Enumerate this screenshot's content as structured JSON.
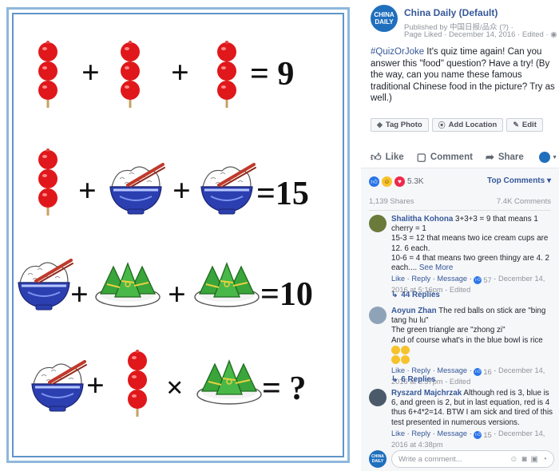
{
  "post": {
    "page_name": "China Daily (Default)",
    "published_by": "Published by 中国日报/品众 (?) · ",
    "page_liked": "Page Liked · December 14, 2016 · Edited · ",
    "avatar_text_1": "CHINA",
    "avatar_text_2": "DAILY",
    "hashtag": "#QuizOrJoke",
    "text": " It's quiz time again! Can you answer this \"food\" question? Have a try! (By the way, can you name these famous traditional Chinese food in the picture? Try as well.)"
  },
  "buttons": {
    "tag_photo": "Tag Photo",
    "add_location": "Add Location",
    "edit": "Edit",
    "like": "Like",
    "comment": "Comment",
    "share": "Share"
  },
  "stats": {
    "reactions": "5.3K",
    "top_comments": "Top Comments ▾",
    "shares": "1,139 Shares",
    "comments": "7.4K Comments"
  },
  "comments": [
    {
      "name": "Shalitha Kohona",
      "text": "3+3+3 = 9 that means 1 cherry = 1",
      "line2": "15-3 = 12 that means two ice cream cups are 12. 6 each.",
      "line3": "10-6 = 4 that means two green thingy are 4. 2 each....",
      "see_more": "See More",
      "like": "Like",
      "reply": "Reply",
      "message": "Message",
      "likes": "57",
      "date": "December 14, 2016 at 5:16pm",
      "edited": "Edited",
      "replies": "44 Replies"
    },
    {
      "name": "Aoyun Zhan",
      "text": "The red balls on stick are \"bing tang hu lu\"",
      "line2": "The green triangle are \"zhong zi\"",
      "line3": "And of course what's in the blue bowl is rice",
      "like": "Like",
      "reply": "Reply",
      "message": "Message",
      "likes": "16",
      "date": "December 14, 2016 at 5:37pm",
      "edited": "Edited",
      "replies": "6 Replies"
    },
    {
      "name": "Ryszard Majchrzak",
      "text": "Although red is 3, blue is 6, and green is 2, but in last equation, red is 4 thus 6+4*2=14. BTW I am sick and tired of this test presented in numerous versions.",
      "like": "Like",
      "reply": "Reply",
      "message": "Message",
      "likes": "15",
      "date": "December 14, 2016 at 4:38pm"
    }
  ],
  "write_placeholder": "Write a comment...",
  "puzzle": {
    "row1_result": "= 9",
    "row2_result": "=15",
    "row3_result": "=10",
    "row4_result": "= ?",
    "plus": "+",
    "times": "×"
  },
  "icons": [
    "tag-icon",
    "location-icon",
    "pencil-icon",
    "like-icon",
    "comment-icon",
    "share-icon",
    "camera-icon",
    "gif-icon",
    "sticker-icon",
    "emoji-icon"
  ],
  "colors": {
    "fb_blue": "#365899",
    "frame_blue": "#5f95c8",
    "candy_red": "#e0181b",
    "bowl_blue": "#2c3fb0",
    "leaf_green": "#3aa53a"
  }
}
